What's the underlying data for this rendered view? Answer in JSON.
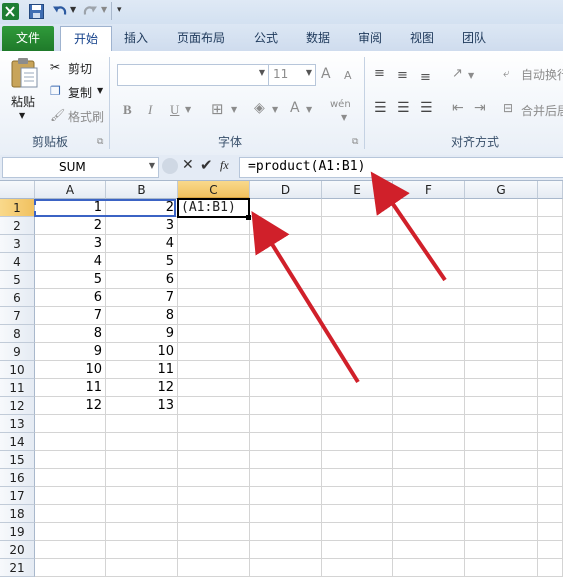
{
  "tabs": [
    "文件",
    "开始",
    "插入",
    "页面布局",
    "公式",
    "数据",
    "审阅",
    "视图",
    "团队"
  ],
  "clipboard": {
    "paste": "粘贴",
    "cut": "剪切",
    "copy": "复制",
    "format_painter": "格式刷",
    "group": "剪贴板"
  },
  "font": {
    "font_size": "11",
    "bold": "B",
    "italic": "I",
    "underline": "U",
    "grow": "A",
    "shrink": "A",
    "group": "字体",
    "wen": "wén"
  },
  "alignment": {
    "wrap": "自动换行",
    "merge": "合并后居",
    "group": "对齐方式"
  },
  "formula_bar": {
    "name_box": "SUM",
    "fx": "fx",
    "formula": "=product(A1:B1)"
  },
  "columns": [
    "A",
    "B",
    "C",
    "D",
    "E",
    "F",
    "G"
  ],
  "rows": [
    "1",
    "2",
    "3",
    "4",
    "5",
    "6",
    "7",
    "8",
    "9",
    "10",
    "11",
    "12",
    "13",
    "14",
    "15",
    "16",
    "17",
    "18",
    "19",
    "20",
    "21"
  ],
  "col_a": [
    "1",
    "2",
    "3",
    "4",
    "5",
    "6",
    "7",
    "8",
    "9",
    "10",
    "11",
    "12"
  ],
  "col_b": [
    "2",
    "3",
    "4",
    "5",
    "6",
    "7",
    "8",
    "9",
    "10",
    "11",
    "12",
    "13"
  ],
  "active_cell_text": "(A1:B1)",
  "colors": {
    "file_tab": "#217a2a",
    "selected_header": "#f1c15f",
    "arrow": "#d0202a"
  }
}
